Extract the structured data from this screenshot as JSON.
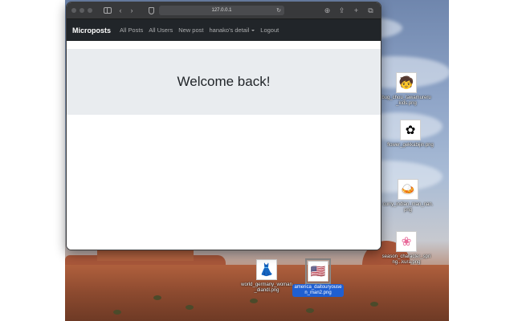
{
  "browser": {
    "url": "127.0.0.1"
  },
  "navbar": {
    "brand": "Microposts",
    "links": [
      "All Posts",
      "All Users",
      "New post"
    ],
    "dropdown_label": "hanako's detail",
    "logout": "Logout"
  },
  "main": {
    "heading": "Welcome back!"
  },
  "desktop": {
    "icons": [
      {
        "label": "bug_chou_tawamureru_kids.png",
        "icon": "kids-butterfly-icon"
      },
      {
        "label": "flower_gekkabijin.png",
        "icon": "flower-icon"
      },
      {
        "label": "curry_indian_man_nan.png",
        "icon": "curry-man-icon"
      },
      {
        "label": "season_character_spring...kura.png",
        "icon": "sakura-icon"
      },
      {
        "label": "world_germany_woman_diandl.png",
        "icon": "germany-woman-icon"
      },
      {
        "label": "america_daitouryousen_man2.png",
        "icon": "america-flag-man-icon",
        "selected": true
      }
    ]
  },
  "colors": {
    "navbar_bg": "#212529",
    "jumbotron_bg": "#e9ecef",
    "selection_blue": "#1f5fd1"
  }
}
